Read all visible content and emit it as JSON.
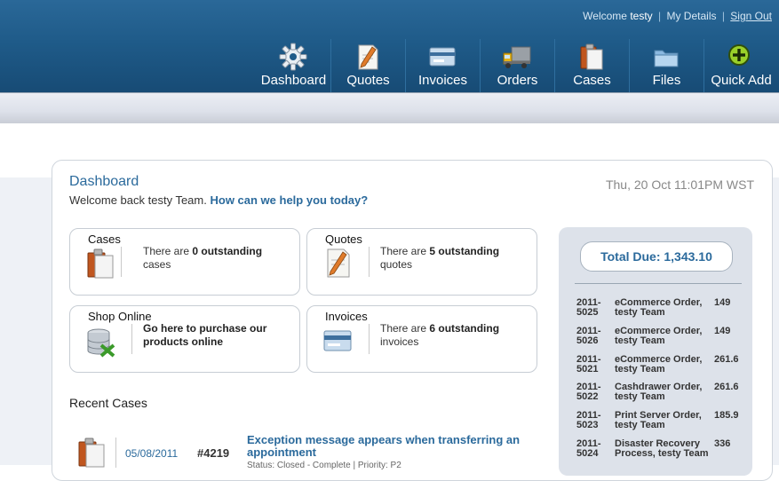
{
  "topbar": {
    "welcome_prefix": "Welcome",
    "username": "testy",
    "my_details": "My Details",
    "sign_out": "Sign Out"
  },
  "nav": [
    {
      "label": "Dashboard",
      "icon": "gear-icon"
    },
    {
      "label": "Quotes",
      "icon": "document-pencil-icon"
    },
    {
      "label": "Invoices",
      "icon": "invoice-card-icon"
    },
    {
      "label": "Orders",
      "icon": "truck-icon"
    },
    {
      "label": "Cases",
      "icon": "clipboard-icon"
    },
    {
      "label": "Files",
      "icon": "folder-icon"
    },
    {
      "label": "Quick Add",
      "icon": "plus-circle-icon"
    }
  ],
  "dashboard": {
    "title": "Dashboard",
    "welcome_text": "Welcome back testy Team.",
    "help_link": "How can we help you today?",
    "datetime": "Thu, 20 Oct 11:01PM WST"
  },
  "cards": [
    {
      "title": "Cases",
      "pre": "There are ",
      "bold": "0 outstanding",
      "post": " cases",
      "icon": "clipboard-icon"
    },
    {
      "title": "Quotes",
      "pre": "There are ",
      "bold": "5 outstanding",
      "post": " quotes",
      "icon": "document-pencil-icon"
    },
    {
      "title": "Shop Online",
      "pre": "",
      "bold": "Go here to purchase our products online",
      "post": "",
      "icon": "database-cart-icon"
    },
    {
      "title": "Invoices",
      "pre": "There are ",
      "bold": "6 outstanding",
      "post": " invoices",
      "icon": "invoice-card-icon"
    }
  ],
  "recent_cases": {
    "heading": "Recent Cases",
    "rows": [
      {
        "date": "05/08/2011",
        "number": "#4219",
        "title": "Exception message appears when transferring an appointment",
        "status": "Status: Closed - Complete | Priority: P2"
      }
    ]
  },
  "orders_panel": {
    "total_label": "Total Due: 1,343.10",
    "orders": [
      {
        "number": "2011-5025",
        "desc": "eCommerce Order, testy Team",
        "amount": "149"
      },
      {
        "number": "2011-5026",
        "desc": "eCommerce Order, testy Team",
        "amount": "149"
      },
      {
        "number": "2011-5021",
        "desc": "eCommerce Order, testy Team",
        "amount": "261.6"
      },
      {
        "number": "2011-5022",
        "desc": "Cashdrawer Order, testy Team",
        "amount": "261.6"
      },
      {
        "number": "2011-5023",
        "desc": "Print Server Order, testy Team",
        "amount": "185.9"
      },
      {
        "number": "2011-5024",
        "desc": "Disaster Recovery Process, testy Team",
        "amount": "336"
      }
    ]
  },
  "colors": {
    "header_top": "#2a6898",
    "header_bottom": "#174b75",
    "accent_blue": "#2b6a9c",
    "sidebox_bg": "#dde2ea"
  }
}
